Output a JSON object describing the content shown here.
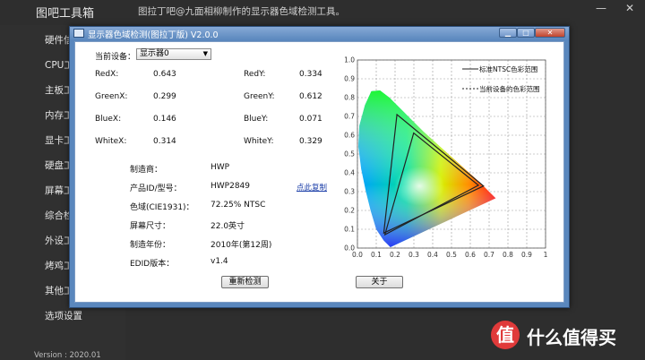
{
  "app": {
    "title": "图吧工具箱",
    "subtitle": "图拉丁吧@九面相柳制作的显示器色域检测工具。",
    "minimize_glyph": "—",
    "close_glyph": "✕",
    "version": "Version : 2020.01",
    "sidebar_items": [
      "硬件信",
      "CPU工",
      "主板工",
      "内存工",
      "显卡工",
      "硬盘工",
      "屏幕工",
      "综合检",
      "外设工",
      "烤鸡工",
      "其他工",
      "选项设置"
    ]
  },
  "dialog": {
    "title": "显示器色域检测(图拉丁版) V2.0.0",
    "min_glyph": "▁",
    "max_glyph": "□",
    "close_glyph": "✕",
    "device_label": "当前设备：",
    "device_value": "显示器0",
    "coords": [
      {
        "label": "RedX:",
        "value": "0.643"
      },
      {
        "label": "RedY:",
        "value": "0.334"
      },
      {
        "label": "GreenX:",
        "value": "0.299"
      },
      {
        "label": "GreenY:",
        "value": "0.612"
      },
      {
        "label": "BlueX:",
        "value": "0.146"
      },
      {
        "label": "BlueY:",
        "value": "0.071"
      },
      {
        "label": "WhiteX:",
        "value": "0.314"
      },
      {
        "label": "WhiteY:",
        "value": "0.329"
      }
    ],
    "info": [
      {
        "label": "制造商：",
        "value": "HWP"
      },
      {
        "label": "产品ID/型号：",
        "value": "HWP2849"
      },
      {
        "label": "色域(CIE1931)：",
        "value": "72.25% NTSC"
      },
      {
        "label": "屏幕尺寸：",
        "value": "22.0英寸"
      },
      {
        "label": "制造年份：",
        "value": "2010年(第12周)"
      },
      {
        "label": "EDID版本：",
        "value": "v1.4"
      }
    ],
    "copy_link": "点此复制",
    "recheck_button": "重新检测",
    "about_button": "关于"
  },
  "chart_data": {
    "type": "scatter",
    "xlim": [
      0,
      1
    ],
    "ylim": [
      0,
      1
    ],
    "x_ticks": [
      "0.0",
      "0.1",
      "0.2",
      "0.3",
      "0.4",
      "0.5",
      "0.6",
      "0.7",
      "0.8",
      "0.9",
      "1"
    ],
    "y_ticks": [
      "0.0",
      "0.1",
      "0.2",
      "0.3",
      "0.4",
      "0.5",
      "0.6",
      "0.7",
      "0.8",
      "0.9",
      "1.0"
    ],
    "grid": true,
    "legend_position": "top-right",
    "series": [
      {
        "name": "标准NTSC色彩范围",
        "style": "solid",
        "points": [
          [
            0.67,
            0.33
          ],
          [
            0.21,
            0.71
          ],
          [
            0.14,
            0.08
          ]
        ]
      },
      {
        "name": "当前设备的色彩范围",
        "style": "dashed",
        "points": [
          [
            0.643,
            0.334
          ],
          [
            0.299,
            0.612
          ],
          [
            0.146,
            0.071
          ]
        ]
      }
    ],
    "locus": [
      [
        0.175,
        0.005
      ],
      [
        0.17,
        0.01
      ],
      [
        0.16,
        0.02
      ],
      [
        0.14,
        0.04
      ],
      [
        0.1,
        0.1
      ],
      [
        0.07,
        0.2
      ],
      [
        0.045,
        0.3
      ],
      [
        0.02,
        0.42
      ],
      [
        0.005,
        0.54
      ],
      [
        0.01,
        0.65
      ],
      [
        0.04,
        0.76
      ],
      [
        0.074,
        0.834
      ],
      [
        0.12,
        0.838
      ],
      [
        0.17,
        0.8
      ],
      [
        0.25,
        0.72
      ],
      [
        0.35,
        0.62
      ],
      [
        0.45,
        0.53
      ],
      [
        0.55,
        0.44
      ],
      [
        0.65,
        0.35
      ],
      [
        0.735,
        0.265
      ]
    ]
  }
}
